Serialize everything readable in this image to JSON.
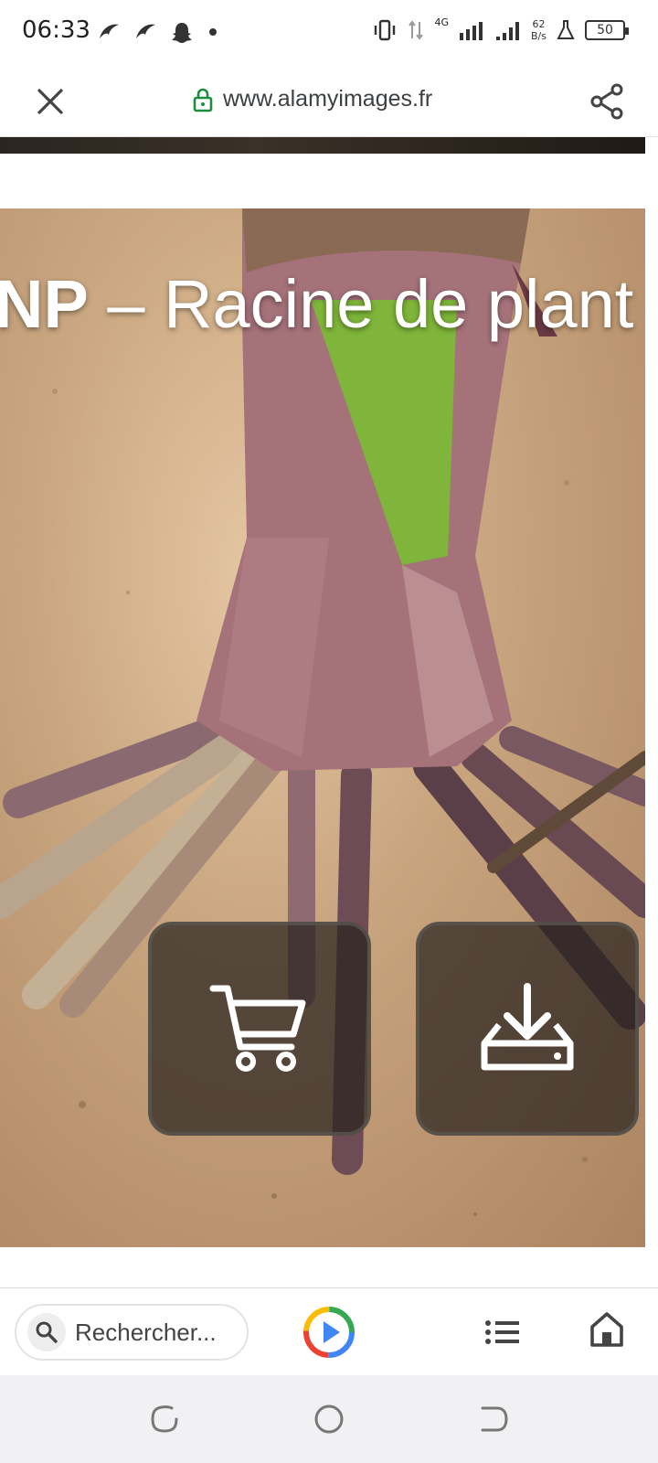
{
  "status_bar": {
    "time": "06:33",
    "network_type": "4G",
    "net_speed_value": "62",
    "net_speed_unit": "B/s",
    "battery": "50"
  },
  "url_bar": {
    "url": "www.alamyimages.fr",
    "secure_lock_color": "#1e8e3e"
  },
  "page": {
    "title_bold": "NP",
    "title_rest": " – Racine de plant"
  },
  "toolbar": {
    "search_placeholder": "Rechercher..."
  },
  "icons": {
    "close": "close-icon",
    "lock": "lock-icon",
    "share": "share-icon",
    "cart": "cart-icon",
    "download": "download-icon",
    "search": "search-icon",
    "assistant": "assistant-play-icon",
    "menu": "menu-list-icon",
    "home": "home-icon"
  }
}
